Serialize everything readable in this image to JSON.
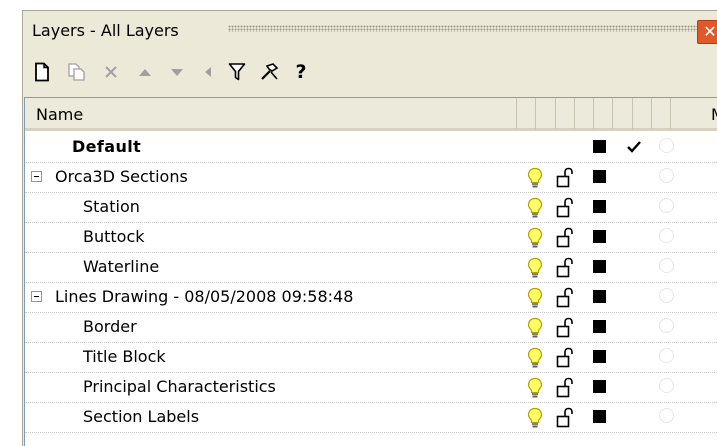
{
  "window": {
    "title": "Layers - All Layers",
    "close_glyph": "✕"
  },
  "toolbar": {
    "buttons": [
      {
        "name": "new-layer-icon",
        "enabled": true
      },
      {
        "name": "new-sublayer-icon",
        "enabled": false
      },
      {
        "name": "delete-icon",
        "enabled": false
      },
      {
        "name": "move-up-icon",
        "enabled": false
      },
      {
        "name": "move-down-icon",
        "enabled": false
      },
      {
        "name": "move-left-icon",
        "enabled": false
      },
      {
        "name": "filter-icon",
        "enabled": true
      },
      {
        "name": "tools-icon",
        "enabled": true
      },
      {
        "name": "help-icon",
        "enabled": true
      }
    ],
    "help_label": "?"
  },
  "columns": {
    "name": "Name",
    "truncated_last": "M"
  },
  "colors": {
    "panel_bg": "#ece9d8",
    "bulb_fill": "#ffff66",
    "bulb_stroke": "#b8a000",
    "swatch": "#000000",
    "disabled_icon": "#a0a0a0"
  },
  "layers": [
    {
      "name": "Default",
      "bold": true,
      "indent": 0,
      "expander": false,
      "current": true,
      "show_bulb": false,
      "show_lock": false
    },
    {
      "name": "Orca3D Sections",
      "bold": false,
      "indent": 0,
      "expander": true,
      "current": false,
      "show_bulb": true,
      "show_lock": true
    },
    {
      "name": "Station",
      "bold": false,
      "indent": 1,
      "expander": false,
      "current": false,
      "show_bulb": true,
      "show_lock": true
    },
    {
      "name": "Buttock",
      "bold": false,
      "indent": 1,
      "expander": false,
      "current": false,
      "show_bulb": true,
      "show_lock": true
    },
    {
      "name": "Waterline",
      "bold": false,
      "indent": 1,
      "expander": false,
      "current": false,
      "show_bulb": true,
      "show_lock": true
    },
    {
      "name": "Lines Drawing - 08/05/2008 09:58:48",
      "bold": false,
      "indent": 0,
      "expander": true,
      "current": false,
      "show_bulb": true,
      "show_lock": true
    },
    {
      "name": "Border",
      "bold": false,
      "indent": 1,
      "expander": false,
      "current": false,
      "show_bulb": true,
      "show_lock": true
    },
    {
      "name": "Title Block",
      "bold": false,
      "indent": 1,
      "expander": false,
      "current": false,
      "show_bulb": true,
      "show_lock": true
    },
    {
      "name": "Principal Characteristics",
      "bold": false,
      "indent": 1,
      "expander": false,
      "current": false,
      "show_bulb": true,
      "show_lock": true
    },
    {
      "name": "Section Labels",
      "bold": false,
      "indent": 1,
      "expander": false,
      "current": false,
      "show_bulb": true,
      "show_lock": true
    }
  ]
}
